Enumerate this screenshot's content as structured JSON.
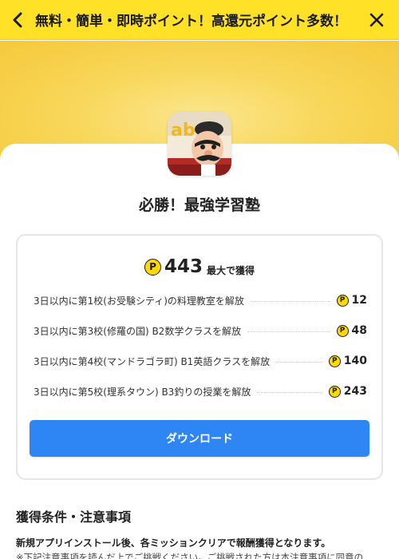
{
  "header": {
    "title": "無料・簡単・即時ポイント！高還元ポイント多数！"
  },
  "app": {
    "name": "必勝！最強学習塾"
  },
  "reward": {
    "coin_symbol": "P",
    "total": "443",
    "total_unit": "最大で獲得",
    "missions": [
      {
        "label": "3日以内に第1校(お受験シティ)の料理教室を解放",
        "points": "12"
      },
      {
        "label": "3日以内に第3校(修羅の国) B2数学クラスを解放",
        "points": "48"
      },
      {
        "label": "3日以内に第4校(マンドラゴラ町) B1英語クラスを解放",
        "points": "140"
      },
      {
        "label": "3日以内に第5校(理系タウン) B3釣りの授業を解放",
        "points": "243"
      }
    ],
    "download_label": "ダウンロード"
  },
  "conditions": {
    "title": "獲得条件・注意事項",
    "notice": "新規アプリインストール後、各ミッションクリアで報酬獲得となります。",
    "sub": "※下記注意事項を読んだ上でご挑戦ください。ご挑戦された方は本注意事項に同意の"
  },
  "colors": {
    "header_bg": "#ffe227",
    "hero_bg": "#f8d75a",
    "coin": "#ffd900",
    "button": "#2e86f5"
  }
}
